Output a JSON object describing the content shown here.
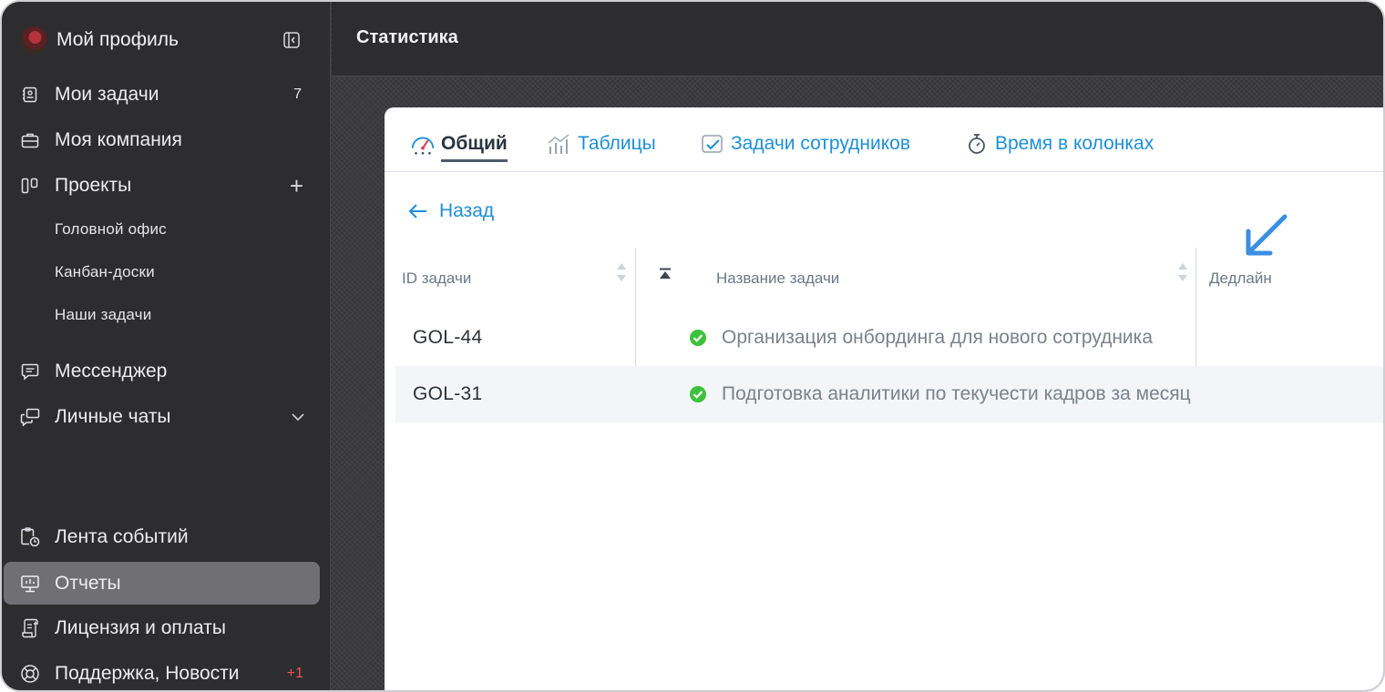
{
  "sidebar": {
    "profile_name": "Мой профиль",
    "items": [
      {
        "label": "Мои задачи",
        "icon": "tasks-icon",
        "count": "7"
      },
      {
        "label": "Моя компания",
        "icon": "company-icon"
      },
      {
        "label": "Проекты",
        "icon": "projects-icon",
        "action": "+"
      },
      {
        "label": "Мессенджер",
        "icon": "messenger-icon"
      },
      {
        "label": "Личные чаты",
        "icon": "chats-icon"
      },
      {
        "label": "Лента событий",
        "icon": "events-icon"
      },
      {
        "label": "Отчеты",
        "icon": "reports-icon"
      },
      {
        "label": "Лицензия и оплаты",
        "icon": "license-icon"
      },
      {
        "label": "Поддержка, Новости",
        "icon": "support-icon",
        "badge": "+1"
      }
    ],
    "projects": [
      "Головной офис",
      "Канбан-доски",
      "Наши задачи"
    ]
  },
  "header": {
    "title": "Статистика"
  },
  "tabs": [
    {
      "label": "Общий",
      "icon": "speedometer-icon",
      "active": true
    },
    {
      "label": "Таблицы",
      "icon": "bar-chart-icon"
    },
    {
      "label": "Задачи сотрудников",
      "icon": "checked-calendar-icon"
    },
    {
      "label": "Время в колонках",
      "icon": "stopwatch-icon"
    }
  ],
  "back_label": "Назад",
  "table": {
    "columns": [
      "ID задачи",
      "Название задачи",
      "Дедлайн"
    ],
    "rows": [
      {
        "id": "GOL-44",
        "name": "Организация онбординга для нового сотрудника",
        "status": "done"
      },
      {
        "id": "GOL-31",
        "name": "Подготовка аналитики по текучести кадров за месяц",
        "status": "done"
      }
    ]
  },
  "colors": {
    "accent": "#1e8fd8",
    "sidebar_bg": "#2d2d30",
    "active_item_bg": "#707074",
    "status_done": "#3cc23c",
    "badge": "#f0525a",
    "annotation_arrow": "#3b8ee0"
  }
}
